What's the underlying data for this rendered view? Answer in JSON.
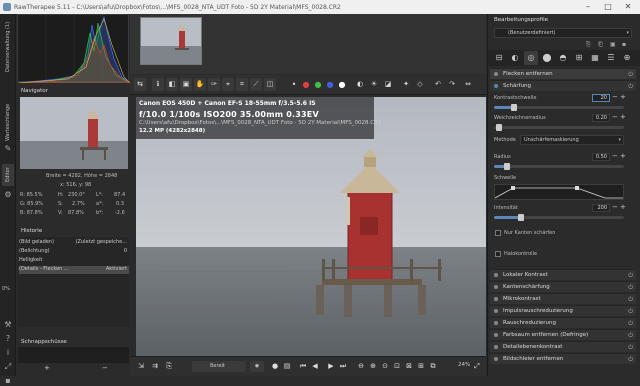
{
  "window": {
    "title": "RawTherapee 5.11 - C:\\Users\\afu\\Dropbox\\Fotos\\...\\MFS_0028_NTA_UDT Foto - 5D 2Y Material\\MFS_0028.CR2",
    "minimize": "–",
    "maximize": "□",
    "close": "✕"
  },
  "left_tabs": {
    "dateiverwaltung": "Dateiverwaltung (1)",
    "warteschlange": "Warteschlange",
    "editor": "Editor"
  },
  "left_zoom_label": "0%",
  "navigator": {
    "title": "Navigator",
    "size_line": "Breite = 4282, Höhe = 2848",
    "coord_line": "x: 516, y: 98",
    "rows": [
      {
        "k": "R:",
        "v": "85.5%",
        "k2": "H:",
        "v2": "230.0°",
        "k3": "L*:",
        "v3": "87.4"
      },
      {
        "k": "G:",
        "v": "85.9%",
        "k2": "S:",
        "v2": "2.7%",
        "k3": "a*:",
        "v3": "0.3"
      },
      {
        "k": "B:",
        "v": "87.8%",
        "k2": "V:",
        "v2": "87.8%",
        "k3": "b*:",
        "v3": "-2.6"
      }
    ]
  },
  "history": {
    "title": "Historie",
    "items": [
      {
        "left": "(Bild geladen)",
        "right": "(Zuletzt gespeiche..."
      },
      {
        "left": "(Belichtung)",
        "right": "0"
      },
      {
        "left": "Helligkeit",
        "right": ""
      },
      {
        "left": "(Details - Flecken ...",
        "right": "Aktiviert"
      }
    ]
  },
  "snapshots": {
    "title": "Schnappschüsse",
    "add": "+",
    "remove": "−"
  },
  "exif": {
    "camera": "Canon EOS 450D + Canon EF-S 18-55mm f/3.5-5.6 IS",
    "settings": "f/10.0  1/100s  ISO200  35.00mm  0.33EV",
    "path": "C:\\Users\\afu\\Dropbox\\Fotos\\...\\MFS_0028_NTA_UDT Foto - 5D 2Y Material\\MFS_0028.CR2",
    "megapixels": "12.2 MP (4282x2848)"
  },
  "bottom": {
    "status": "Bereit",
    "zoom": "24%"
  },
  "right": {
    "profile_title": "Bearbeitungsprofile",
    "profile_value": "(Benutzerdefiniert)",
    "section_active": "Flecken entfernen",
    "subsection": "Schärfung",
    "params": {
      "kontrastschwelle_label": "Kontrastschwelle",
      "kontrastschwelle_val": "20",
      "weichzeichnerradius_label": "Weichzeichnerradius",
      "weichzeichnerradius_val": "0.20",
      "methode_label": "Methode",
      "methode_val": "Unschärfemaskierung",
      "radius_label": "Radius",
      "radius_val": "0.50",
      "schwelle_label": "Schwelle",
      "intensitaet_label": "Intensität",
      "intensitaet_val": "200",
      "nur_kanten": "Nur Kanten schärfen",
      "halokontrolle": "Halokontrolle"
    },
    "sections": [
      "Lokaler Kontrast",
      "Kantenschärfung",
      "Mikrokontrast",
      "Impulsrauschreduzierung",
      "Rauschreduzierung",
      "Farbsaum entfernen (Defringe)",
      "Detailebenenkontrast",
      "Bildschleier entfernen"
    ]
  },
  "colors": {
    "accent": "#5a86b8",
    "panel": "#2b2b2b",
    "dark": "#1c1c1c"
  }
}
